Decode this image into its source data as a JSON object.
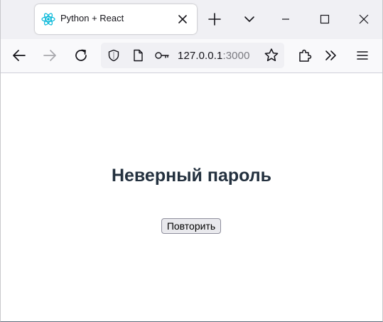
{
  "browser": {
    "tab": {
      "title": "Python + React",
      "favicon": "react-logo-icon"
    },
    "tabstrip_icons": [
      "new-tab-plus-icon",
      "tab-list-chevron-icon",
      "minimize-icon",
      "maximize-icon",
      "close-window-icon"
    ],
    "nav_icons": [
      "back-arrow-icon",
      "forward-arrow-icon",
      "reload-icon"
    ],
    "url": {
      "host": "127.0.0.1",
      "port": ":3000"
    },
    "toolbar_icons": [
      "bookmark-star-icon",
      "extensions-icon",
      "overflow-chevrons-icon",
      "hamburger-menu-icon"
    ],
    "colors": {
      "tabstrip_bg": "#f0f0f4",
      "navbar_bg": "#f9f9fb",
      "heading": "#24313f",
      "react_cyan": "#00b6d8"
    }
  },
  "page": {
    "heading": "Неверный пароль",
    "retry_label": "Повторить"
  }
}
